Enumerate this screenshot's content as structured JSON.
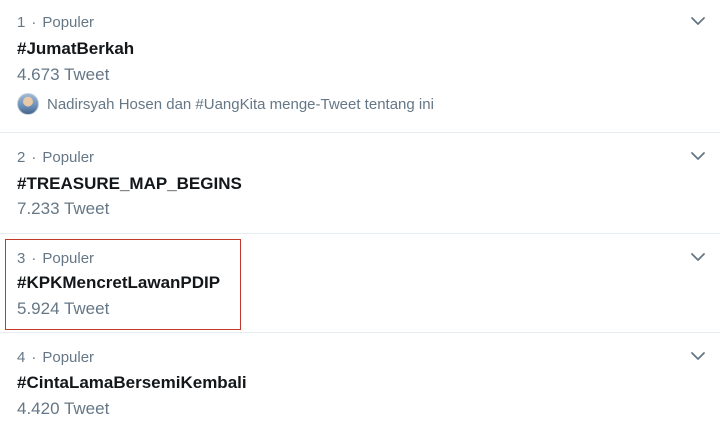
{
  "trends": [
    {
      "rank": "1",
      "category": "Populer",
      "tag": "#JumatBerkah",
      "count": "4.673 Tweet",
      "context": "Nadirsyah Hosen dan #UangKita menge-Tweet tentang ini"
    },
    {
      "rank": "2",
      "category": "Populer",
      "tag": "#TREASURE_MAP_BEGINS",
      "count": "7.233 Tweet"
    },
    {
      "rank": "3",
      "category": "Populer",
      "tag": "#KPKMencretLawanPDIP",
      "count": "5.924 Tweet"
    },
    {
      "rank": "4",
      "category": "Populer",
      "tag": "#CintaLamaBersemiKembali",
      "count": "4.420 Tweet"
    }
  ],
  "separator": "·",
  "colors": {
    "secondary_text": "#657786",
    "primary_text": "#14171a",
    "divider": "#e6ecf0",
    "highlight": "#c0392b",
    "accent": "#1da1f2"
  },
  "icons": {
    "caret": "chevron-down-icon"
  }
}
